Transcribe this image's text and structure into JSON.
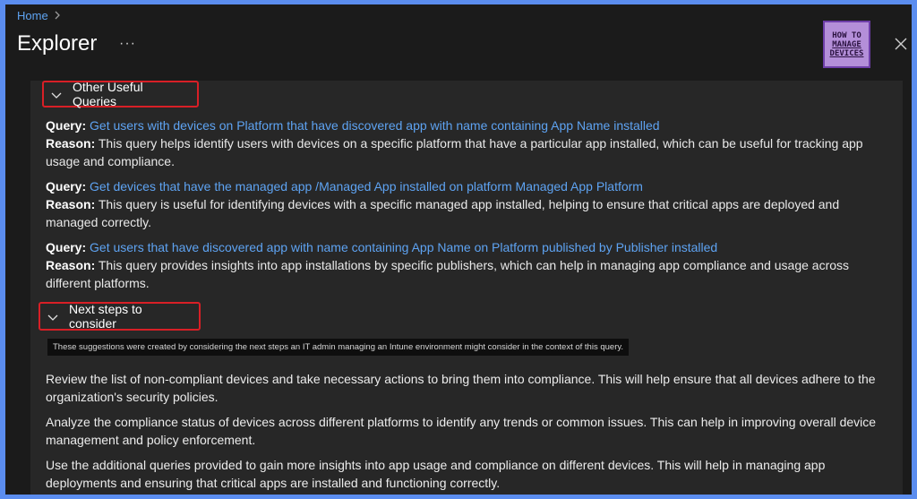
{
  "breadcrumb": {
    "home": "Home"
  },
  "header": {
    "title": "Explorer",
    "more": "···"
  },
  "logo": {
    "line1": "HOW TO",
    "line2": "MANAGE",
    "line3": "DEVICES"
  },
  "sections": {
    "other": {
      "label": "Other Useful Queries"
    },
    "next": {
      "label": "Next steps to consider"
    }
  },
  "query_label": "Query:",
  "reason_label": "Reason:",
  "queries": [
    {
      "link": "Get users with devices on Platform that have discovered app with name containing App Name installed",
      "reason": "This query helps identify users with devices on a specific platform that have a particular app installed, which can be useful for tracking app usage and compliance."
    },
    {
      "link": "Get devices that have the managed app /Managed App installed on platform Managed App Platform",
      "reason": "This query is useful for identifying devices with a specific managed app installed, helping to ensure that critical apps are deployed and managed correctly."
    },
    {
      "link": "Get users that have discovered app with name containing App Name on Platform published by Publisher installed",
      "reason": "This query provides insights into app installations by specific publishers, which can help in managing app compliance and usage across different platforms."
    }
  ],
  "note": "These suggestions were created by considering the next steps an IT admin managing an Intune environment might consider in the context of this query.",
  "next_steps": [
    "Review the list of non-compliant devices and take necessary actions to bring them into compliance. This will help ensure that all devices adhere to the organization's security policies.",
    "Analyze the compliance status of devices across different platforms to identify any trends or common issues. This can help in improving overall device management and policy enforcement.",
    "Use the additional queries provided to gain more insights into app usage and compliance on different devices. This will help in managing app deployments and ensuring that critical apps are installed and functioning correctly."
  ],
  "colors": {
    "accent_link": "#5ea3f2",
    "highlight_border": "#d81f26",
    "background": "#1b1b1b",
    "panel": "#272727"
  },
  "icons": [
    "chevron-right-icon",
    "more-icon",
    "close-icon",
    "chevron-down-icon"
  ]
}
